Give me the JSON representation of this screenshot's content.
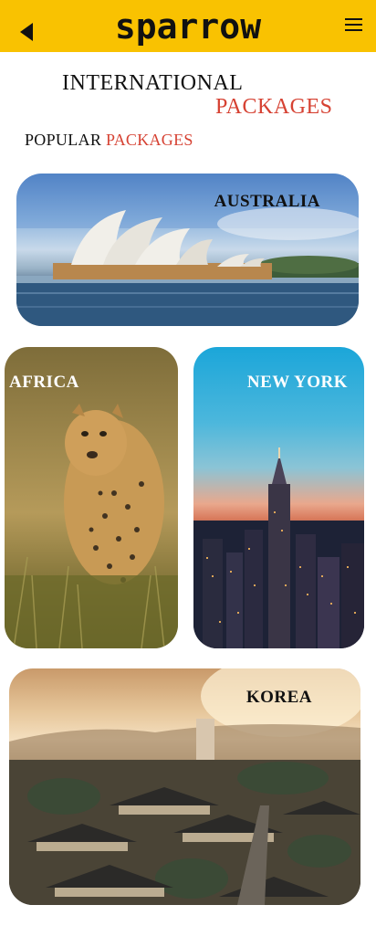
{
  "app": {
    "brand": "sparrow"
  },
  "header": {
    "back_icon": "back-arrow-icon",
    "menu_icon": "hamburger-menu-icon",
    "background": "#f9c201"
  },
  "page": {
    "title_part1": "INTERNATIONAL",
    "title_part2": "PACKAGES",
    "subtitle_part1": "POPULAR",
    "subtitle_part2": "PACKAGES",
    "accent_color": "#d64233"
  },
  "packages": [
    {
      "label": "AUSTRALIA",
      "label_color": "#111111"
    },
    {
      "label": "AFRICA",
      "label_color": "#ffffff"
    },
    {
      "label": "NEW YORK",
      "label_color": "#ffffff"
    },
    {
      "label": "KOREA",
      "label_color": "#111111"
    }
  ]
}
